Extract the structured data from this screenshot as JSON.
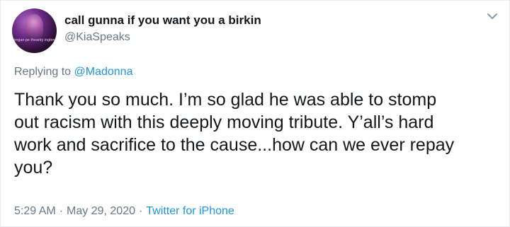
{
  "author": {
    "display_name": "call gunna if you want you a birkin",
    "handle": "@KiaSpeaks",
    "avatar_caption": "ongun pe theanty ingbin"
  },
  "reply": {
    "prefix": "Replying to ",
    "mention": "@Madonna"
  },
  "tweet": {
    "lines": [
      "Thank you so much. I’m so glad he was able to stomp",
      "out racism with this deeply moving tribute. Y’all’s hard",
      "work and sacrifice to the cause...how can we ever repay",
      "you?"
    ]
  },
  "meta": {
    "time": "5:29 AM",
    "separator": "·",
    "date": "May 29, 2020",
    "source": "Twitter for iPhone"
  },
  "icons": {
    "menu": "chevron-down-icon"
  },
  "colors": {
    "link": "#1b95e0",
    "secondary_text": "#657786",
    "primary_text": "#14171a",
    "border": "#e6ecf0"
  }
}
